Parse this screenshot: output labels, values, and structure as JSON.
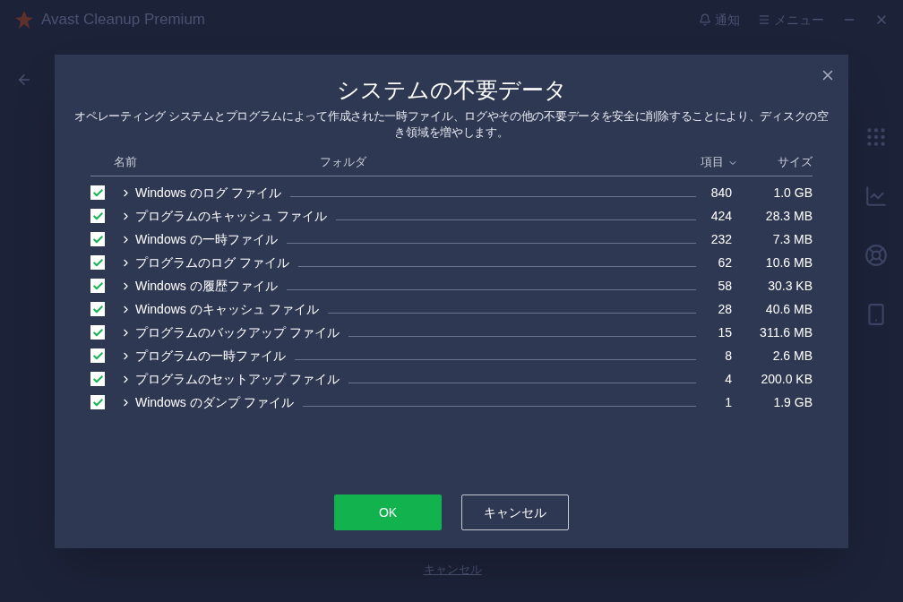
{
  "app": {
    "title": "Avast Cleanup Premium",
    "notifications": "通知",
    "menu": "メニュー",
    "cancel_link": "キャンセル"
  },
  "dialog": {
    "title": "システムの不要データ",
    "description": "オペレーティング システムとプログラムによって作成された一時ファイル、ログやその他の不要データを安全に削除することにより、ディスクの空き領域を増やします。",
    "columns": {
      "name": "名前",
      "folder": "フォルダ",
      "count": "項目",
      "size": "サイズ"
    },
    "rows": [
      {
        "name": "Windows のログ ファイル",
        "checked": true,
        "count": "840",
        "size": "1.0 GB"
      },
      {
        "name": "プログラムのキャッシュ ファイル",
        "checked": true,
        "count": "424",
        "size": "28.3 MB"
      },
      {
        "name": "Windows の一時ファイル",
        "checked": true,
        "count": "232",
        "size": "7.3 MB"
      },
      {
        "name": "プログラムのログ ファイル",
        "checked": true,
        "count": "62",
        "size": "10.6 MB"
      },
      {
        "name": "Windows の履歴ファイル",
        "checked": true,
        "count": "58",
        "size": "30.3 KB"
      },
      {
        "name": "Windows のキャッシュ ファイル",
        "checked": true,
        "count": "28",
        "size": "40.6 MB"
      },
      {
        "name": "プログラムのバックアップ ファイル",
        "checked": true,
        "count": "15",
        "size": "311.6 MB"
      },
      {
        "name": "プログラムの一時ファイル",
        "checked": true,
        "count": "8",
        "size": "2.6 MB"
      },
      {
        "name": "プログラムのセットアップ ファイル",
        "checked": true,
        "count": "4",
        "size": "200.0 KB"
      },
      {
        "name": "Windows のダンプ ファイル",
        "checked": true,
        "count": "1",
        "size": "1.9 GB"
      }
    ],
    "ok": "OK",
    "cancel": "キャンセル"
  }
}
